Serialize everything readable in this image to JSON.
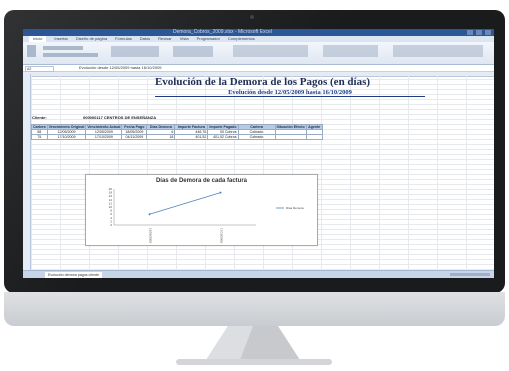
{
  "window": {
    "title": "Demora_Cobros_2009.xlsx - Microsoft Excel"
  },
  "ribbon": {
    "tabs": [
      "Inicio",
      "Insertar",
      "Diseño de página",
      "Fórmulas",
      "Datos",
      "Revisar",
      "Vista",
      "Programador",
      "Complementos"
    ],
    "active_tab": "Inicio"
  },
  "formula_bar": {
    "cell": "A2",
    "content": "Evolución desde 12/05/2009 hasta 16/10/2009"
  },
  "sheet": {
    "title": "Evolución de la Demora de los Pagos (en días)",
    "subtitle": "Evolución desde 12/05/2009 hasta 16/10/2009",
    "client_label": "Cliente:",
    "client_name": "000000117 CENTROS DE ENSEÑANZA",
    "headers": [
      "Cartera",
      "Vencimiento Original",
      "Vencimiento Actual",
      "Fecha Pago",
      "Días Demora",
      "Importe Factura",
      "Importe Pagado",
      "Cartera",
      "Situación Efecto",
      "Agente"
    ],
    "rows": [
      [
        "58",
        "12/05/2009",
        "12/05/2009",
        "18/05/2009",
        "6",
        "446,76",
        "00 Cobros",
        "Cobrado",
        "",
        ""
      ],
      [
        "75",
        "17/10/2009",
        "17/10/2009",
        "04/11/2009",
        "18",
        "401,52",
        "401,52 Cobros",
        "Cobrado",
        "",
        ""
      ]
    ],
    "tab_name": "Evolución demora pagos cliente"
  },
  "chart_data": {
    "type": "line",
    "title": "Días de Demora de cada factura",
    "categories": [
      "12/05/2009",
      "17/10/2009"
    ],
    "series": [
      {
        "name": "Días Demora",
        "values": [
          6,
          18
        ]
      }
    ],
    "yticks": [
      0,
      2,
      4,
      6,
      8,
      10,
      12,
      14,
      16,
      18,
      20
    ],
    "ylim": [
      0,
      20
    ],
    "legend": "right",
    "color": "#4f81bd"
  }
}
